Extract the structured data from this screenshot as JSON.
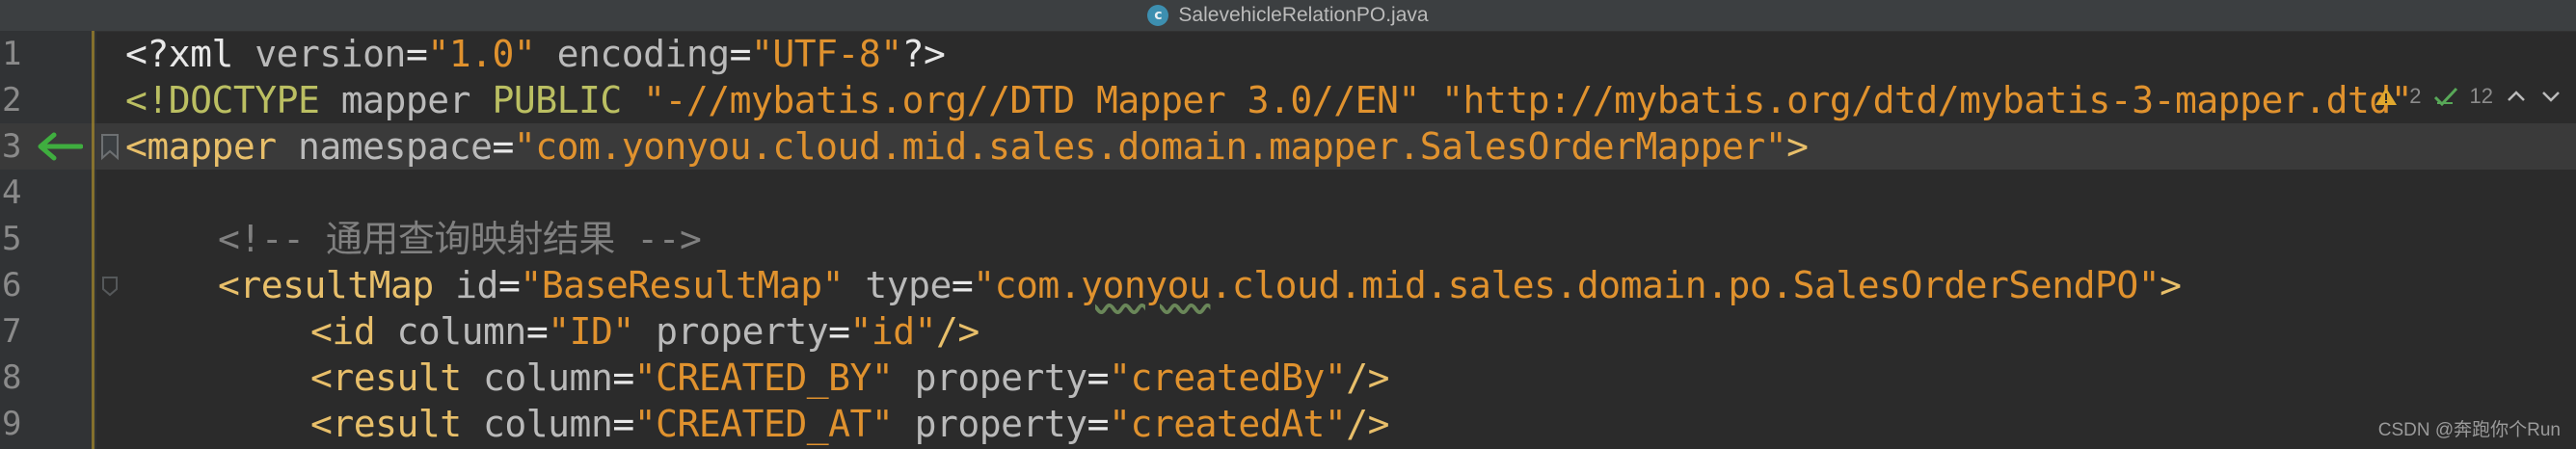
{
  "window": {
    "file_icon_letter": "c",
    "title": "SalevehicleRelationPO.java"
  },
  "inspections": {
    "warnings": "2",
    "weak_warnings": "12"
  },
  "lines": [
    {
      "number": "1"
    },
    {
      "number": "2"
    },
    {
      "number": "3"
    },
    {
      "number": "4"
    },
    {
      "number": "5"
    },
    {
      "number": "6"
    },
    {
      "number": "7"
    },
    {
      "number": "8"
    },
    {
      "number": "9"
    }
  ],
  "code": {
    "l1_open": "<?xml ",
    "l1_attr1": "version",
    "l1_eq1": "=",
    "l1_val1": "\"1.0\"",
    "l1_attr2": " encoding",
    "l1_eq2": "=",
    "l1_val2": "\"UTF-8\"",
    "l1_close": "?>",
    "l2_open": "<!DOCTYPE ",
    "l2_name": "mapper ",
    "l2_kw": "PUBLIC ",
    "l2_val1": "\"-//mybatis.org//DTD Mapper 3.0//EN\"",
    "l2_sp": " ",
    "l2_val2": "\"http://mybatis.org/dtd/mybatis-3-mapper.dtd\"",
    "l3_open": "<",
    "l3_tag": "mapper",
    "l3_attr": " namespace",
    "l3_eq": "=",
    "l3_val": "\"com.yonyou.cloud.mid.sales.domain.mapper.SalesOrderMapper\"",
    "l3_close": ">",
    "l5_comment": "<!-- 通用查询映射结果 -->",
    "l6_open": "<",
    "l6_tag": "resultMap",
    "l6_attr1": " id",
    "l6_eq1": "=",
    "l6_val1": "\"BaseResultMap\"",
    "l6_attr2": " type",
    "l6_eq2": "=",
    "l6_val2a": "\"com.",
    "l6_val2b": "yonyou",
    "l6_val2c": ".cloud.mid.sales.domain.po.SalesOrderSendPO\"",
    "l6_close": ">",
    "l7_open": "<",
    "l7_tag": "id",
    "l7_attr1": " column",
    "l7_eq1": "=",
    "l7_val1": "\"ID\"",
    "l7_attr2": " property",
    "l7_eq2": "=",
    "l7_val2": "\"id\"",
    "l7_close": "/>",
    "l8_open": "<",
    "l8_tag": "result",
    "l8_attr1": " column",
    "l8_eq1": "=",
    "l8_val1": "\"CREATED_BY\"",
    "l8_attr2": " property",
    "l8_eq2": "=",
    "l8_val2": "\"createdBy\"",
    "l8_close": "/>",
    "l9_open": "<",
    "l9_tag": "result",
    "l9_attr1": " column",
    "l9_eq1": "=",
    "l9_val1": "\"CREATED_AT\"",
    "l9_attr2": " property",
    "l9_eq2": "=",
    "l9_val2": "\"createdAt\"",
    "l9_close": "/>"
  },
  "watermark": "CSDN @奔跑你个Run",
  "colors": {
    "background": "#2b2b2b",
    "string": "#e0922e",
    "tag": "#e8bf6a",
    "comment": "#808080",
    "arrow": "#3fae3f"
  },
  "icons": [
    "java-class-icon",
    "back-arrow-icon",
    "bookmark-icon",
    "fold-icon",
    "warning-icon",
    "weak-warning-icon",
    "chevron-up-icon",
    "chevron-down-icon"
  ]
}
